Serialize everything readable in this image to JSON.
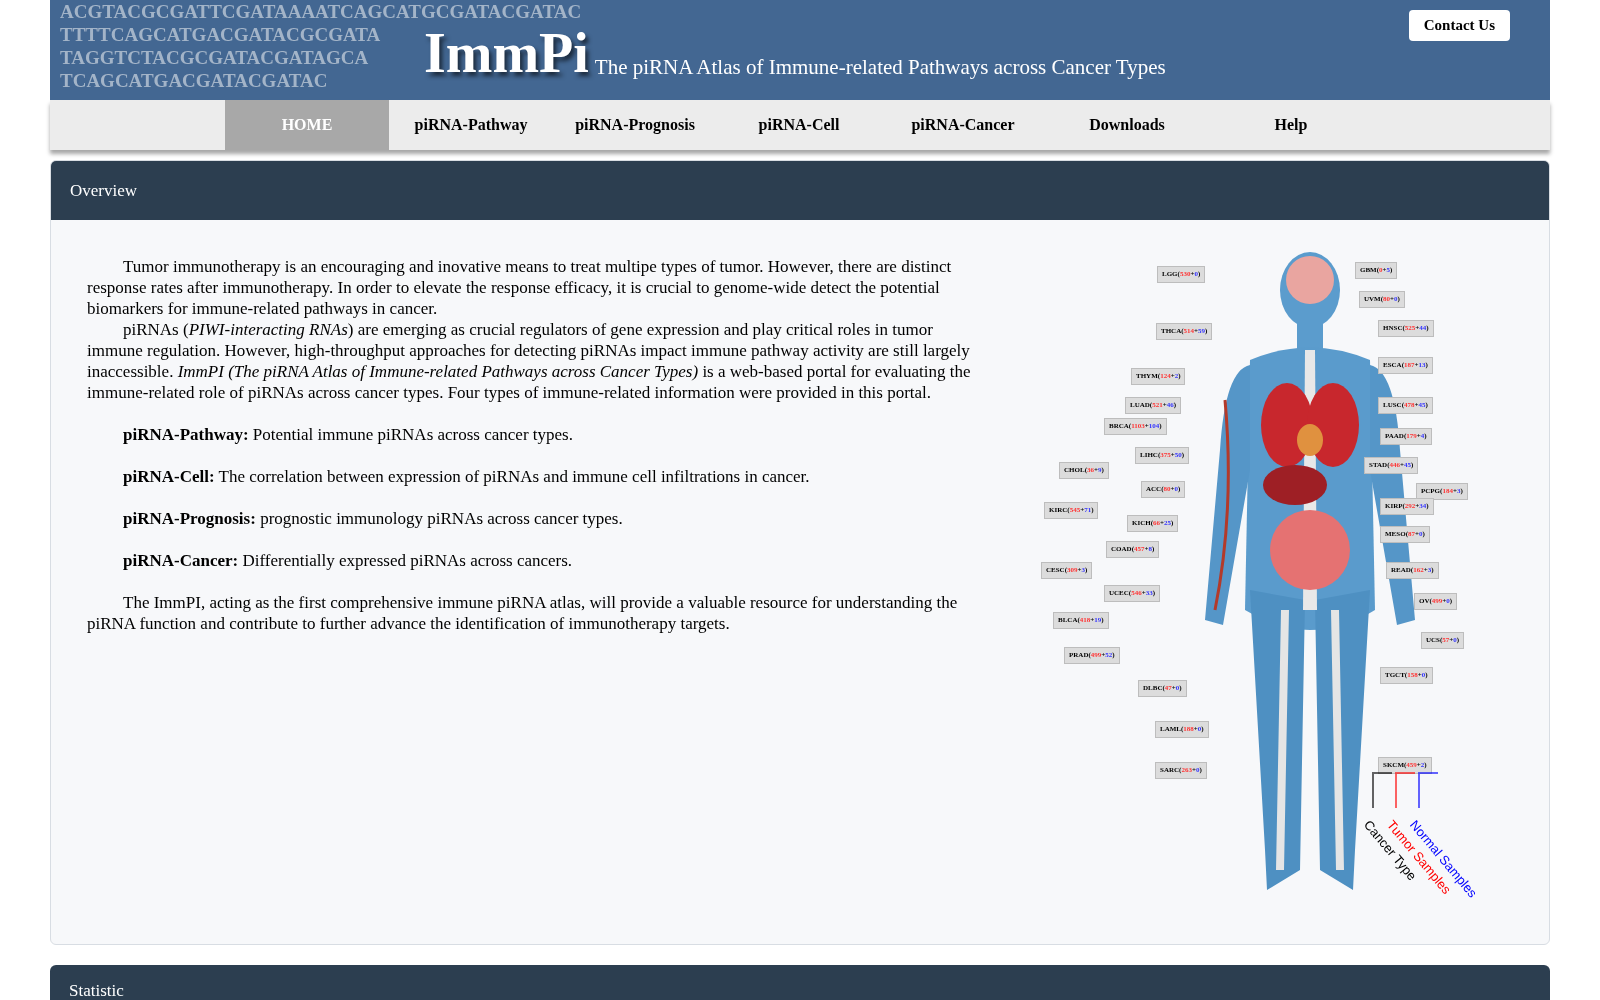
{
  "header": {
    "dna_lines": [
      "ACGTACGCGATTCGATAAAATCAGCATGCGATACGATAC",
      "TTTTCAGCATGACGATACGCGATA",
      "TAGGTCTACGCGATACGATAGCA",
      "TCAGCATGACGATACGATAC"
    ],
    "logo": "ImmPi",
    "subtitle": "The piRNA Atlas of Immune-related Pathways across Cancer Types",
    "contact_button": "Contact Us"
  },
  "nav": [
    {
      "label": "HOME",
      "selected": true
    },
    {
      "label": "piRNA-Pathway",
      "selected": false
    },
    {
      "label": "piRNA-Prognosis",
      "selected": false
    },
    {
      "label": "piRNA-Cell",
      "selected": false
    },
    {
      "label": "piRNA-Cancer",
      "selected": false
    },
    {
      "label": "Downloads",
      "selected": false
    },
    {
      "label": "Help",
      "selected": false
    }
  ],
  "overview": {
    "title": "Overview",
    "intro": [
      "Tumor immunotherapy is an encouraging and inovative means to treat multipe types of tumor. However, there are distinct response rates after immunotherapy. In order to elevate the response efficacy, it is crucial to genome-wide detect the potential biomarkers for immune-related pathways in cancer.",
      "piRNAs (*PIWI-interacting RNAs*) are emerging as crucial regulators of gene expression and play critical roles in tumor immune regulation. However, high-throughput approaches for detecting piRNAs impact immune pathway activity are still largely inaccessible. *ImmPI (The piRNA Atlas of Immune-related Pathways across Cancer Types)* is a web-based portal for evaluating the immune-related role of piRNAs across cancer types. Four types of immune-related information were provided in this portal."
    ],
    "features": [
      "**piRNA-Pathway:** Potential immune piRNAs across cancer types.",
      "**piRNA-Cell:** The correlation between expression of piRNAs and immune cell infiltrations in cancer.",
      "**piRNA-Prognosis:** prognostic immunology piRNAs across cancer types.",
      "**piRNA-Cancer:** Differentially expressed piRNAs across cancers."
    ],
    "closing": "The ImmPI, acting as the first comprehensive immune piRNA atlas, will provide a valuable resource for understanding the piRNA function and contribute to further advance the identification of immunotherapy targets.",
    "figure": {
      "labels": [
        {
          "type": "LGG",
          "open": "(",
          "tumor": "530",
          "plus": "+",
          "normal": "0",
          "close": ")"
        },
        {
          "type": "GBM",
          "open": "(",
          "tumor": "0",
          "plus": "+",
          "normal": "5",
          "close": ")"
        },
        {
          "type": "UVM",
          "open": "(",
          "tumor": "80",
          "plus": "+",
          "normal": "0",
          "close": ")"
        },
        {
          "type": "THCA",
          "open": "(",
          "tumor": "514",
          "plus": "+",
          "normal": "59",
          "close": ")"
        },
        {
          "type": "HNSC",
          "open": "(",
          "tumor": "525",
          "plus": "+",
          "normal": "44",
          "close": ")"
        },
        {
          "type": "ESCA",
          "open": "(",
          "tumor": "187",
          "plus": "+",
          "normal": "13",
          "close": ")"
        },
        {
          "type": "THYM",
          "open": "(",
          "tumor": "124",
          "plus": "+",
          "normal": "2",
          "close": ")"
        },
        {
          "type": "LUAD",
          "open": "(",
          "tumor": "521",
          "plus": "+",
          "normal": "46",
          "close": ")"
        },
        {
          "type": "LUSC",
          "open": "(",
          "tumor": "478",
          "plus": "+",
          "normal": "45",
          "close": ")"
        },
        {
          "type": "BRCA",
          "open": "(",
          "tumor": "1103",
          "plus": "+",
          "normal": "104",
          "close": ")"
        },
        {
          "type": "PAAD",
          "open": "(",
          "tumor": "179",
          "plus": "+",
          "normal": "4",
          "close": ")"
        },
        {
          "type": "LIHC",
          "open": "(",
          "tumor": "375",
          "plus": "+",
          "normal": "50",
          "close": ")"
        },
        {
          "type": "STAD",
          "open": "(",
          "tumor": "446",
          "plus": "+",
          "normal": "45",
          "close": ")"
        },
        {
          "type": "CHOL",
          "open": "(",
          "tumor": "36",
          "plus": "+",
          "normal": "9",
          "close": ")"
        },
        {
          "type": "ACC",
          "open": "(",
          "tumor": "80",
          "plus": "+",
          "normal": "0",
          "close": ")"
        },
        {
          "type": "PCPG",
          "open": "(",
          "tumor": "184",
          "plus": "+",
          "normal": "3",
          "close": ")"
        },
        {
          "type": "KIRC",
          "open": "(",
          "tumor": "545",
          "plus": "+",
          "normal": "71",
          "close": ")"
        },
        {
          "type": "KIRP",
          "open": "(",
          "tumor": "292",
          "plus": "+",
          "normal": "34",
          "close": ")"
        },
        {
          "type": "KICH",
          "open": "(",
          "tumor": "66",
          "plus": "+",
          "normal": "25",
          "close": ")"
        },
        {
          "type": "MESO",
          "open": "(",
          "tumor": "87",
          "plus": "+",
          "normal": "0",
          "close": ")"
        },
        {
          "type": "COAD",
          "open": "(",
          "tumor": "457",
          "plus": "+",
          "normal": "8",
          "close": ")"
        },
        {
          "type": "CESC",
          "open": "(",
          "tumor": "309",
          "plus": "+",
          "normal": "3",
          "close": ")"
        },
        {
          "type": "READ",
          "open": "(",
          "tumor": "162",
          "plus": "+",
          "normal": "3",
          "close": ")"
        },
        {
          "type": "UCEC",
          "open": "(",
          "tumor": "546",
          "plus": "+",
          "normal": "33",
          "close": ")"
        },
        {
          "type": "OV",
          "open": "(",
          "tumor": "499",
          "plus": "+",
          "normal": "0",
          "close": ")"
        },
        {
          "type": "BLCA",
          "open": "(",
          "tumor": "418",
          "plus": "+",
          "normal": "19",
          "close": ")"
        },
        {
          "type": "UCS",
          "open": "(",
          "tumor": "57",
          "plus": "+",
          "normal": "0",
          "close": ")"
        },
        {
          "type": "PRAD",
          "open": "(",
          "tumor": "499",
          "plus": "+",
          "normal": "52",
          "close": ")"
        },
        {
          "type": "TGCT",
          "open": "(",
          "tumor": "158",
          "plus": "+",
          "normal": "0",
          "close": ")"
        },
        {
          "type": "DLBC",
          "open": "(",
          "tumor": "47",
          "plus": "+",
          "normal": "0",
          "close": ")"
        },
        {
          "type": "LAML",
          "open": "(",
          "tumor": "188",
          "plus": "+",
          "normal": "0",
          "close": ")"
        },
        {
          "type": "SKCM",
          "open": "(",
          "tumor": "459",
          "plus": "+",
          "normal": "2",
          "close": ")"
        },
        {
          "type": "SARC",
          "open": "(",
          "tumor": "263",
          "plus": "+",
          "normal": "0",
          "close": ")"
        }
      ],
      "legend": [
        {
          "label": "Cancer Type",
          "color": "#000000"
        },
        {
          "label": "Tumor Samples",
          "color": "#ff0000"
        },
        {
          "label": "Normal Samples",
          "color": "#0000ff"
        }
      ]
    }
  },
  "statistic": {
    "title": "Statistic"
  }
}
